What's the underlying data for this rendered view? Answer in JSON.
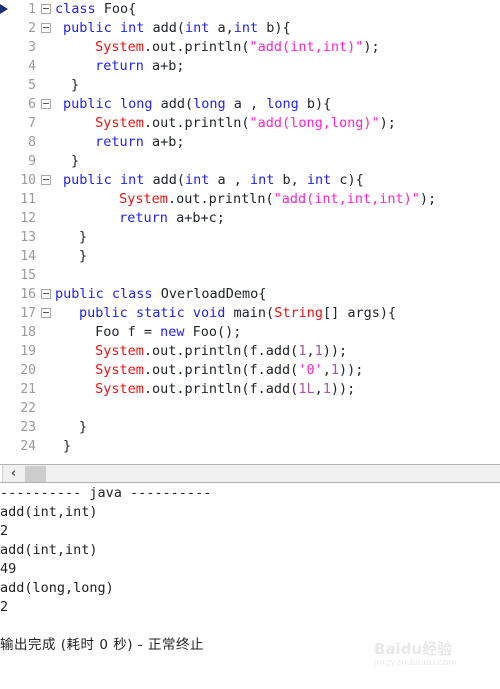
{
  "editor": {
    "marker_line": 1,
    "colors": {
      "keyword": "#2222ee",
      "type": "#ee1111",
      "string": "#ff22cc",
      "number": "#a05a9c",
      "plain": "#20242b",
      "lineno": "#9a9a9a",
      "background": "#ffffff"
    },
    "lines": [
      {
        "n": "1",
        "fold": true,
        "marker": true,
        "indent": 0,
        "tokens": [
          {
            "t": "class",
            "c": "kw"
          },
          {
            "t": " Foo{",
            "c": "pln"
          }
        ]
      },
      {
        "n": "2",
        "fold": true,
        "marker": false,
        "indent": 1,
        "tokens": [
          {
            "t": "public",
            "c": "kw"
          },
          {
            "t": " ",
            "c": "pln"
          },
          {
            "t": "int",
            "c": "kw"
          },
          {
            "t": " add(",
            "c": "pln"
          },
          {
            "t": "int",
            "c": "kw"
          },
          {
            "t": " a,",
            "c": "pln"
          },
          {
            "t": "int",
            "c": "kw"
          },
          {
            "t": " b){",
            "c": "pln"
          }
        ]
      },
      {
        "n": "3",
        "fold": false,
        "marker": false,
        "indent": 5,
        "tokens": [
          {
            "t": "System",
            "c": "typ"
          },
          {
            "t": ".out.println(",
            "c": "pln"
          },
          {
            "t": "\"add(int,int)\"",
            "c": "str"
          },
          {
            "t": ");",
            "c": "pln"
          }
        ]
      },
      {
        "n": "4",
        "fold": false,
        "marker": false,
        "indent": 5,
        "tokens": [
          {
            "t": "return",
            "c": "kw"
          },
          {
            "t": " a+b;",
            "c": "pln"
          }
        ]
      },
      {
        "n": "5",
        "fold": false,
        "marker": false,
        "indent": 2,
        "tokens": [
          {
            "t": "}",
            "c": "pln"
          }
        ]
      },
      {
        "n": "6",
        "fold": true,
        "marker": false,
        "indent": 1,
        "tokens": [
          {
            "t": "public",
            "c": "kw"
          },
          {
            "t": " ",
            "c": "pln"
          },
          {
            "t": "long",
            "c": "kw"
          },
          {
            "t": " add(",
            "c": "pln"
          },
          {
            "t": "long",
            "c": "kw"
          },
          {
            "t": " a , ",
            "c": "pln"
          },
          {
            "t": "long",
            "c": "kw"
          },
          {
            "t": " b){",
            "c": "pln"
          }
        ]
      },
      {
        "n": "7",
        "fold": false,
        "marker": false,
        "indent": 5,
        "tokens": [
          {
            "t": "System",
            "c": "typ"
          },
          {
            "t": ".out.println(",
            "c": "pln"
          },
          {
            "t": "\"add(long,long)\"",
            "c": "str"
          },
          {
            "t": ");",
            "c": "pln"
          }
        ]
      },
      {
        "n": "8",
        "fold": false,
        "marker": false,
        "indent": 5,
        "tokens": [
          {
            "t": "return",
            "c": "kw"
          },
          {
            "t": " a+b;",
            "c": "pln"
          }
        ]
      },
      {
        "n": "9",
        "fold": false,
        "marker": false,
        "indent": 2,
        "tokens": [
          {
            "t": "}",
            "c": "pln"
          }
        ]
      },
      {
        "n": "10",
        "fold": true,
        "marker": false,
        "indent": 1,
        "tokens": [
          {
            "t": "public",
            "c": "kw"
          },
          {
            "t": " ",
            "c": "pln"
          },
          {
            "t": "int",
            "c": "kw"
          },
          {
            "t": " add(",
            "c": "pln"
          },
          {
            "t": "int",
            "c": "kw"
          },
          {
            "t": " a , ",
            "c": "pln"
          },
          {
            "t": "int",
            "c": "kw"
          },
          {
            "t": " b, ",
            "c": "pln"
          },
          {
            "t": "int",
            "c": "kw"
          },
          {
            "t": " c){",
            "c": "pln"
          }
        ]
      },
      {
        "n": "11",
        "fold": false,
        "marker": false,
        "indent": 8,
        "tokens": [
          {
            "t": "System",
            "c": "typ"
          },
          {
            "t": ".out.println(",
            "c": "pln"
          },
          {
            "t": "\"add(int,int,int)\"",
            "c": "str"
          },
          {
            "t": ");",
            "c": "pln"
          }
        ]
      },
      {
        "n": "12",
        "fold": false,
        "marker": false,
        "indent": 8,
        "tokens": [
          {
            "t": "return",
            "c": "kw"
          },
          {
            "t": " a+b+c;",
            "c": "pln"
          }
        ]
      },
      {
        "n": "13",
        "fold": false,
        "marker": false,
        "indent": 3,
        "tokens": [
          {
            "t": "}",
            "c": "pln"
          }
        ]
      },
      {
        "n": "14",
        "fold": false,
        "marker": false,
        "indent": 3,
        "tokens": [
          {
            "t": "}",
            "c": "pln"
          }
        ]
      },
      {
        "n": "15",
        "fold": false,
        "marker": false,
        "indent": 0,
        "tokens": []
      },
      {
        "n": "16",
        "fold": true,
        "marker": false,
        "indent": 0,
        "tokens": [
          {
            "t": "public",
            "c": "kw"
          },
          {
            "t": " ",
            "c": "pln"
          },
          {
            "t": "class",
            "c": "kw"
          },
          {
            "t": " OverloadDemo{",
            "c": "pln"
          }
        ]
      },
      {
        "n": "17",
        "fold": true,
        "marker": false,
        "indent": 3,
        "tokens": [
          {
            "t": "public",
            "c": "kw"
          },
          {
            "t": " ",
            "c": "pln"
          },
          {
            "t": "static",
            "c": "kw"
          },
          {
            "t": " ",
            "c": "pln"
          },
          {
            "t": "void",
            "c": "kw"
          },
          {
            "t": " main(",
            "c": "pln"
          },
          {
            "t": "String",
            "c": "typ"
          },
          {
            "t": "[] args){",
            "c": "pln"
          }
        ]
      },
      {
        "n": "18",
        "fold": false,
        "marker": false,
        "indent": 5,
        "tokens": [
          {
            "t": "Foo f = ",
            "c": "pln"
          },
          {
            "t": "new",
            "c": "kw"
          },
          {
            "t": " Foo();",
            "c": "pln"
          }
        ]
      },
      {
        "n": "19",
        "fold": false,
        "marker": false,
        "indent": 5,
        "tokens": [
          {
            "t": "System",
            "c": "typ"
          },
          {
            "t": ".out.println(f.add(",
            "c": "pln"
          },
          {
            "t": "1",
            "c": "num"
          },
          {
            "t": ",",
            "c": "pln"
          },
          {
            "t": "1",
            "c": "num"
          },
          {
            "t": "));",
            "c": "pln"
          }
        ]
      },
      {
        "n": "20",
        "fold": false,
        "marker": false,
        "indent": 5,
        "tokens": [
          {
            "t": "System",
            "c": "typ"
          },
          {
            "t": ".out.println(f.add(",
            "c": "pln"
          },
          {
            "t": "'0'",
            "c": "str"
          },
          {
            "t": ",",
            "c": "pln"
          },
          {
            "t": "1",
            "c": "num"
          },
          {
            "t": "));",
            "c": "pln"
          }
        ]
      },
      {
        "n": "21",
        "fold": false,
        "marker": false,
        "indent": 5,
        "tokens": [
          {
            "t": "System",
            "c": "typ"
          },
          {
            "t": ".out.println(f.add(",
            "c": "pln"
          },
          {
            "t": "1L",
            "c": "num"
          },
          {
            "t": ",",
            "c": "pln"
          },
          {
            "t": "1",
            "c": "num"
          },
          {
            "t": "));",
            "c": "pln"
          }
        ]
      },
      {
        "n": "22",
        "fold": false,
        "marker": false,
        "indent": 0,
        "tokens": []
      },
      {
        "n": "23",
        "fold": false,
        "marker": false,
        "indent": 3,
        "tokens": [
          {
            "t": "}",
            "c": "pln"
          }
        ]
      },
      {
        "n": "24",
        "fold": false,
        "marker": false,
        "indent": 1,
        "tokens": [
          {
            "t": "}",
            "c": "pln"
          }
        ]
      }
    ]
  },
  "scrollbar": {
    "left_arrow_glyph": "‹",
    "thumb_label": ""
  },
  "console": {
    "lines": [
      "---------- java ----------",
      "add(int,int)",
      "2",
      "add(int,int)",
      "49",
      "add(long,long)",
      "2"
    ],
    "blank_lines_before_status": 1,
    "status": "输出完成 (耗时 0 秒) - 正常终止"
  },
  "watermark": {
    "main": "Baidu经验",
    "sub": "jingyan.baidu.com"
  }
}
